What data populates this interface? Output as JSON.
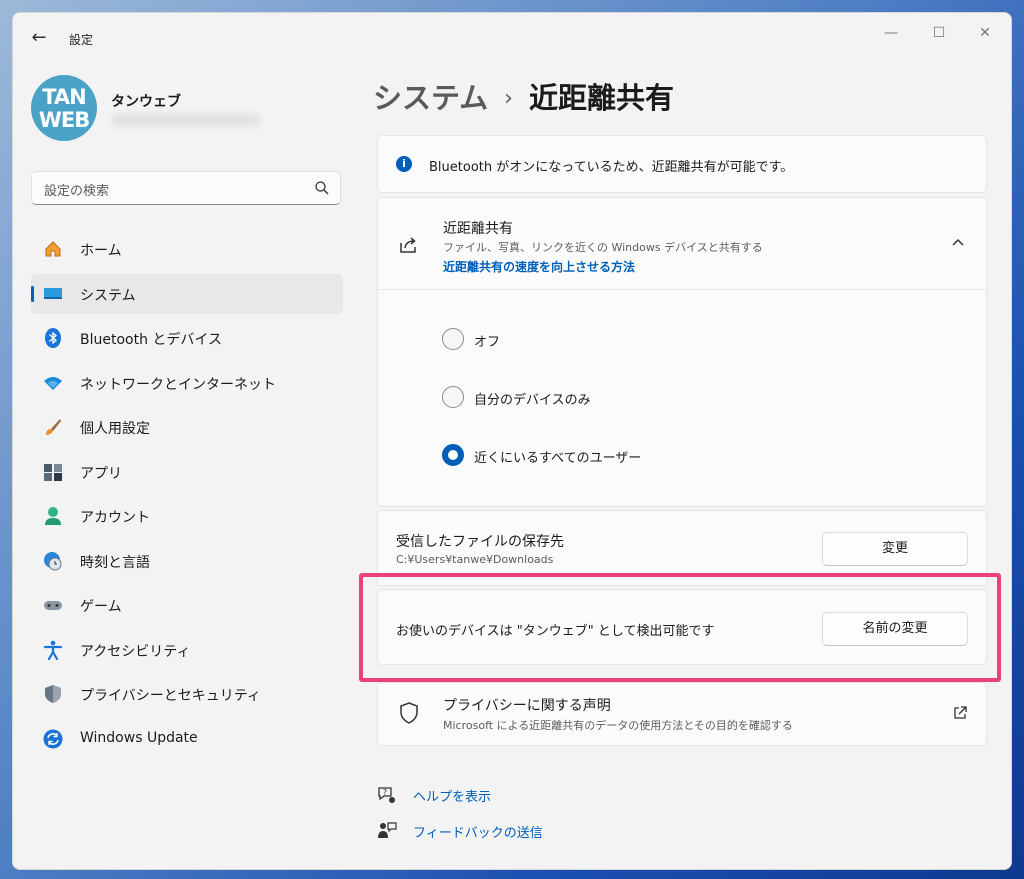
{
  "window": {
    "app_title": "設定",
    "back_glyph": "←",
    "minimize_glyph": "—",
    "maximize_glyph": "☐",
    "close_glyph": "✕"
  },
  "profile": {
    "avatar_line1": "TAN",
    "avatar_line2": "WEB",
    "name": "タンウェブ"
  },
  "search": {
    "placeholder": "設定の検索"
  },
  "sidebar": {
    "items": [
      {
        "label": "ホーム",
        "icon": "home-icon",
        "active": false
      },
      {
        "label": "システム",
        "icon": "system-icon",
        "active": true
      },
      {
        "label": "Bluetooth とデバイス",
        "icon": "bluetooth-icon",
        "active": false
      },
      {
        "label": "ネットワークとインターネット",
        "icon": "wifi-icon",
        "active": false
      },
      {
        "label": "個人用設定",
        "icon": "brush-icon",
        "active": false
      },
      {
        "label": "アプリ",
        "icon": "apps-icon",
        "active": false
      },
      {
        "label": "アカウント",
        "icon": "account-icon",
        "active": false
      },
      {
        "label": "時刻と言語",
        "icon": "time-language-icon",
        "active": false
      },
      {
        "label": "ゲーム",
        "icon": "gamepad-icon",
        "active": false
      },
      {
        "label": "アクセシビリティ",
        "icon": "accessibility-icon",
        "active": false
      },
      {
        "label": "プライバシーとセキュリティ",
        "icon": "shield-icon",
        "active": false
      },
      {
        "label": "Windows Update",
        "icon": "update-icon",
        "active": false
      }
    ]
  },
  "breadcrumb": {
    "parent": "システム",
    "separator": "›",
    "current": "近距離共有"
  },
  "info": {
    "icon_glyph": "i",
    "text": "Bluetooth がオンになっているため、近距離共有が可能です。"
  },
  "share": {
    "title": "近距離共有",
    "description": "ファイル、写真、リンクを近くの Windows デバイスと共有する",
    "link": "近距離共有の速度を向上させる方法",
    "options": [
      {
        "label": "オフ",
        "checked": false
      },
      {
        "label": "自分のデバイスのみ",
        "checked": false
      },
      {
        "label": "近くにいるすべてのユーザー",
        "checked": true
      }
    ]
  },
  "save_location": {
    "title": "受信したファイルの保存先",
    "path": "C:¥Users¥tanwe¥Downloads",
    "button": "変更"
  },
  "device_name": {
    "text": "お使いのデバイスは \"タンウェブ\" として検出可能です",
    "button": "名前の変更"
  },
  "privacy": {
    "title": "プライバシーに関する声明",
    "description": "Microsoft による近距離共有のデータの使用方法とその目的を確認する"
  },
  "footer": {
    "help": "ヘルプを表示",
    "feedback": "フィードバックの送信"
  },
  "colors": {
    "accent": "#005fb8",
    "highlight": "#ec407a",
    "avatar": "#4aa3c7"
  }
}
